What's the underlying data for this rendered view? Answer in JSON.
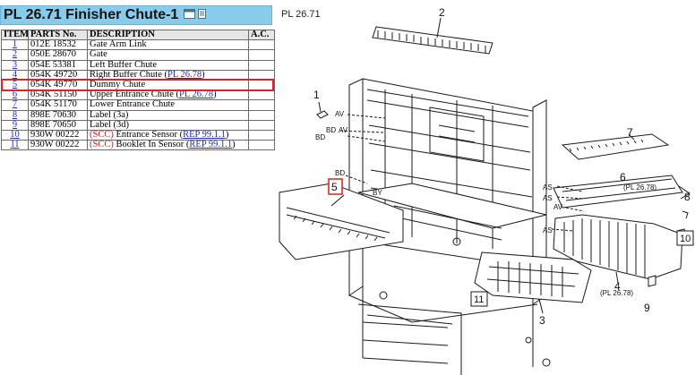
{
  "title": "PL 26.71 Finisher Chute-1",
  "table": {
    "headers": {
      "item": "ITEM",
      "parts_no": "PARTS No.",
      "description": "DESCRIPTION",
      "ac": "A.C."
    },
    "rows": [
      {
        "item": "1",
        "parts_no": "012E 18532",
        "scc": "",
        "desc": "Gate Arm Link",
        "ref": "",
        "ac": ""
      },
      {
        "item": "2",
        "parts_no": "050E 28670",
        "scc": "",
        "desc": "Gate",
        "ref": "",
        "ac": ""
      },
      {
        "item": "3",
        "parts_no": "054E 53381",
        "scc": "",
        "desc": "Left Buffer Chute",
        "ref": "",
        "ac": ""
      },
      {
        "item": "4",
        "parts_no": "054K 49720",
        "scc": "",
        "desc": "Right Buffer Chute",
        "ref": "PL 26.78",
        "ac": ""
      },
      {
        "item": "5",
        "parts_no": "054K 49770",
        "scc": "",
        "desc": "Dummy Chute",
        "ref": "",
        "ac": ""
      },
      {
        "item": "6",
        "parts_no": "054K 51150",
        "scc": "",
        "desc": "Upper Entrance Chute",
        "ref": "PL 26.78",
        "ac": ""
      },
      {
        "item": "7",
        "parts_no": "054K 51170",
        "scc": "",
        "desc": "Lower Entrance Chute",
        "ref": "",
        "ac": ""
      },
      {
        "item": "8",
        "parts_no": "898E 70630",
        "scc": "",
        "desc": "Label (3a)",
        "ref": "",
        "ac": ""
      },
      {
        "item": "9",
        "parts_no": "898E 70650",
        "scc": "",
        "desc": "Label (3d)",
        "ref": "",
        "ac": ""
      },
      {
        "item": "10",
        "parts_no": "930W 00222",
        "scc": "(SCC)",
        "desc": "Entrance Sensor",
        "ref": "REP 99.1.1",
        "ac": ""
      },
      {
        "item": "11",
        "parts_no": "930W 00222",
        "scc": "(SCC)",
        "desc": "Booklet In Sensor",
        "ref": "REP 99.1.1",
        "ac": ""
      }
    ]
  },
  "diagram": {
    "label": "PL 26.71",
    "callouts": [
      "1",
      "2",
      "3",
      "4",
      "5",
      "6",
      "7",
      "8",
      "9",
      "10",
      "11"
    ],
    "refs": [
      "(PL 26.78)",
      "(PL 26.78)"
    ],
    "connectors": [
      "AV",
      "AV",
      "BD",
      "BD",
      "BD",
      "BY",
      "AS",
      "AS",
      "AS",
      "AV"
    ]
  },
  "colors": {
    "title_bg": "#88ccec",
    "highlight": "#e0202c",
    "link": "#1e2fb3",
    "scc": "#d01818"
  }
}
